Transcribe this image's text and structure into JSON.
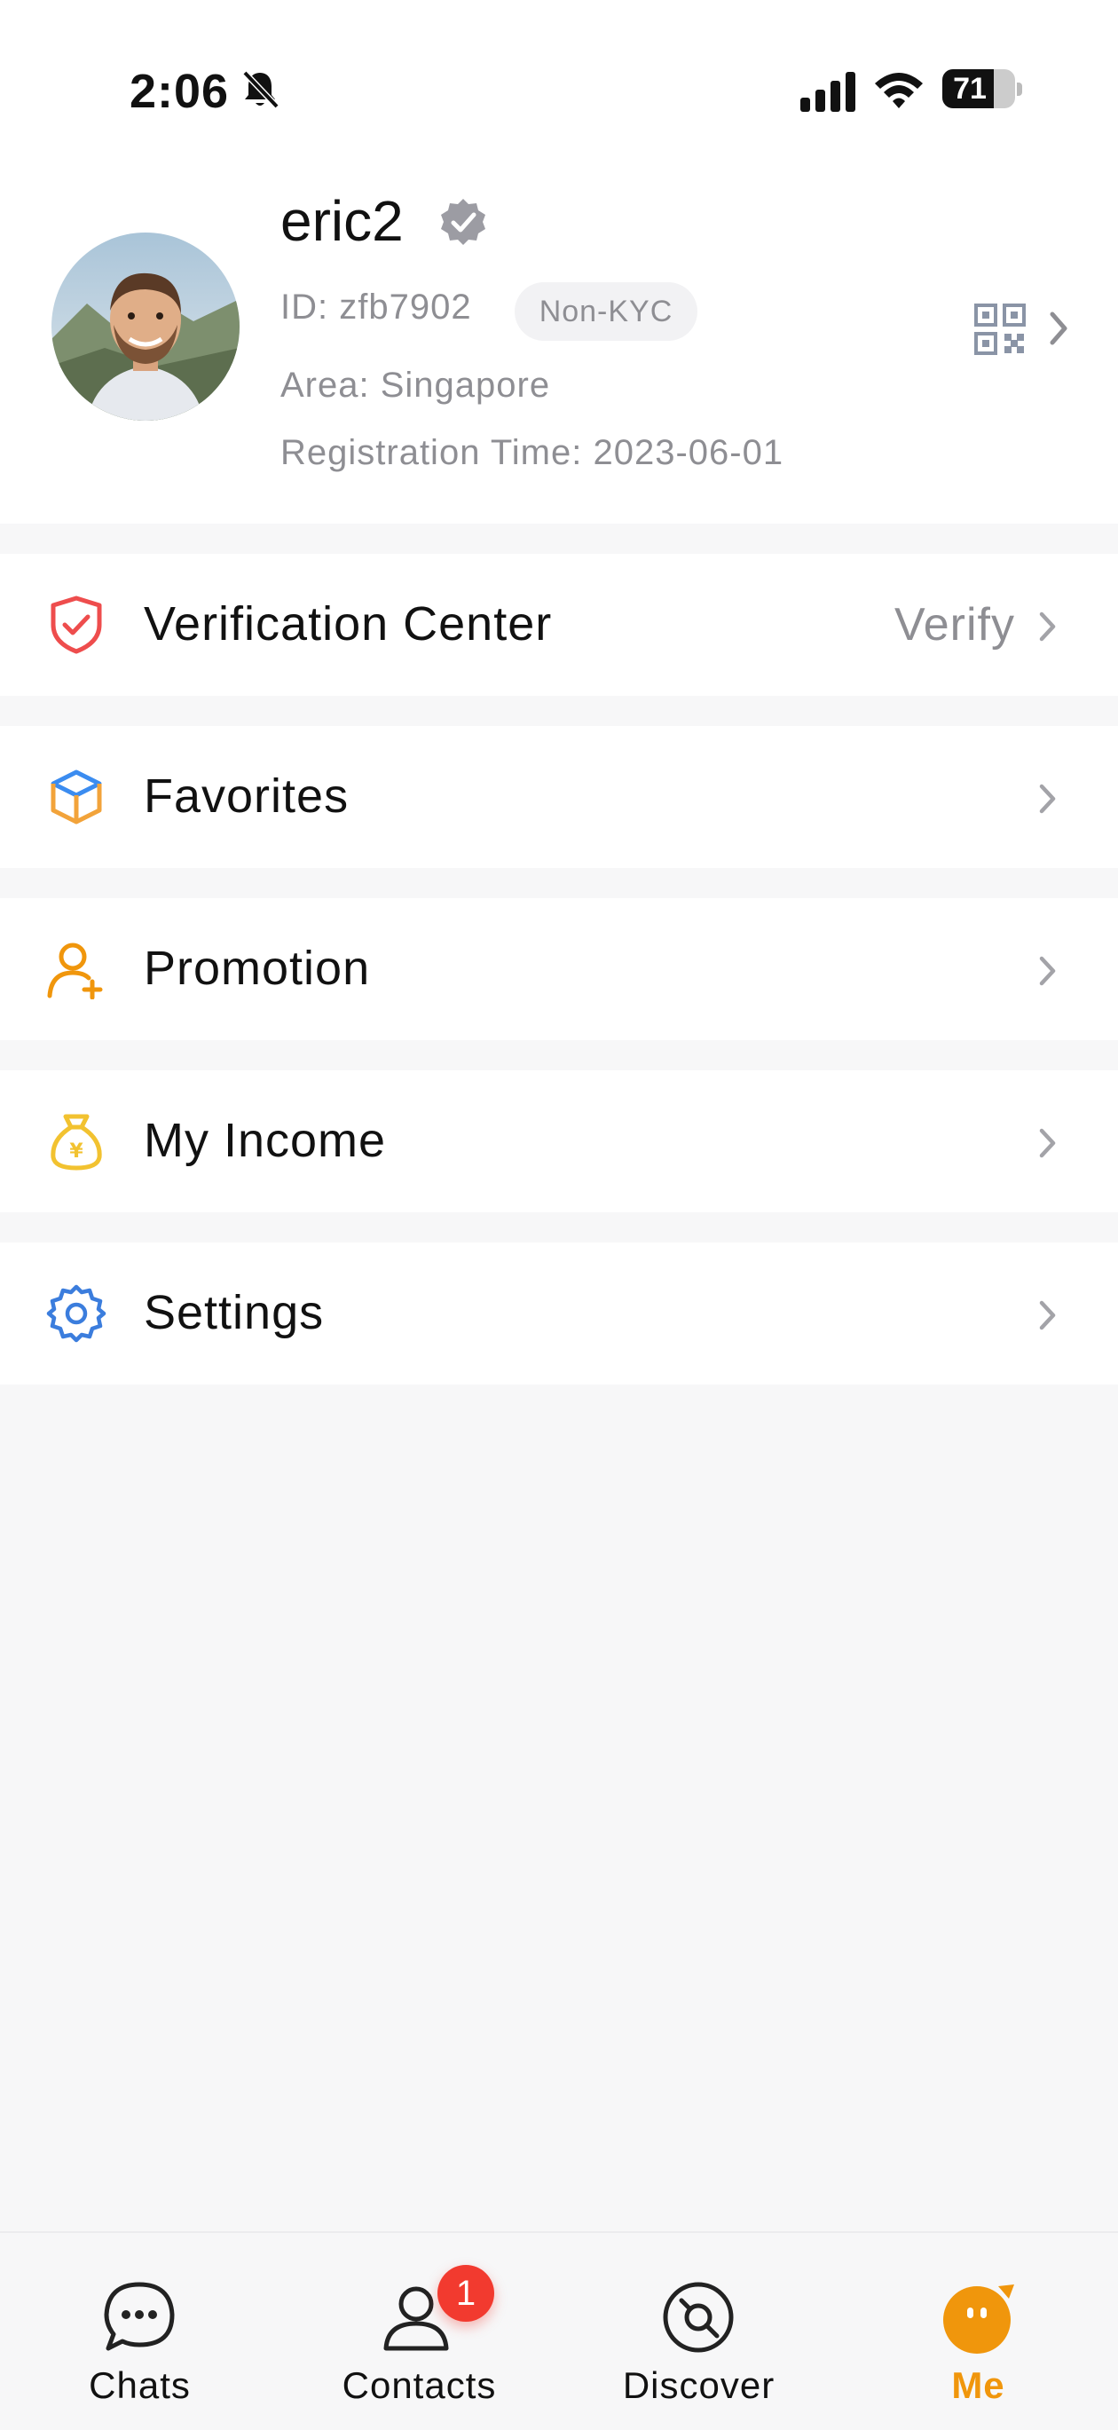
{
  "status_bar": {
    "time": "2:06",
    "battery_level": "71",
    "icons": [
      "bell-slash-icon",
      "signal-icon",
      "wifi-icon",
      "battery-icon"
    ]
  },
  "profile": {
    "username": "eric2",
    "user_id": "ID: zfb7902",
    "kyc_status": "Non-KYC",
    "area": "Area: Singapore",
    "registration": "Registration Time: 2023-06-01",
    "icons": [
      "verified-icon",
      "qr-code-icon",
      "chevron-right-icon"
    ]
  },
  "menu": {
    "items": [
      {
        "label": "Verification Center",
        "value": "Verify",
        "icon": "shield-check-icon"
      },
      {
        "label": "Favorites",
        "value": "",
        "icon": "cube-icon"
      },
      {
        "label": "Promotion",
        "value": "",
        "icon": "user-add-icon"
      },
      {
        "label": "My Income",
        "value": "",
        "icon": "money-bag-icon"
      },
      {
        "label": "Settings",
        "value": "",
        "icon": "gear-icon"
      }
    ]
  },
  "tab_bar": {
    "tabs": [
      {
        "label": "Chats",
        "icon": "chat-bubble-icon",
        "active": false
      },
      {
        "label": "Contacts",
        "icon": "contacts-icon",
        "active": false,
        "badge": "1"
      },
      {
        "label": "Discover",
        "icon": "compass-icon",
        "active": false
      },
      {
        "label": "Me",
        "icon": "me-icon",
        "active": true
      }
    ]
  },
  "colors": {
    "accent": "#F0960C",
    "badge": "#F23A2F",
    "secondary_text": "#8E8E93",
    "background": "#F7F7F8"
  }
}
